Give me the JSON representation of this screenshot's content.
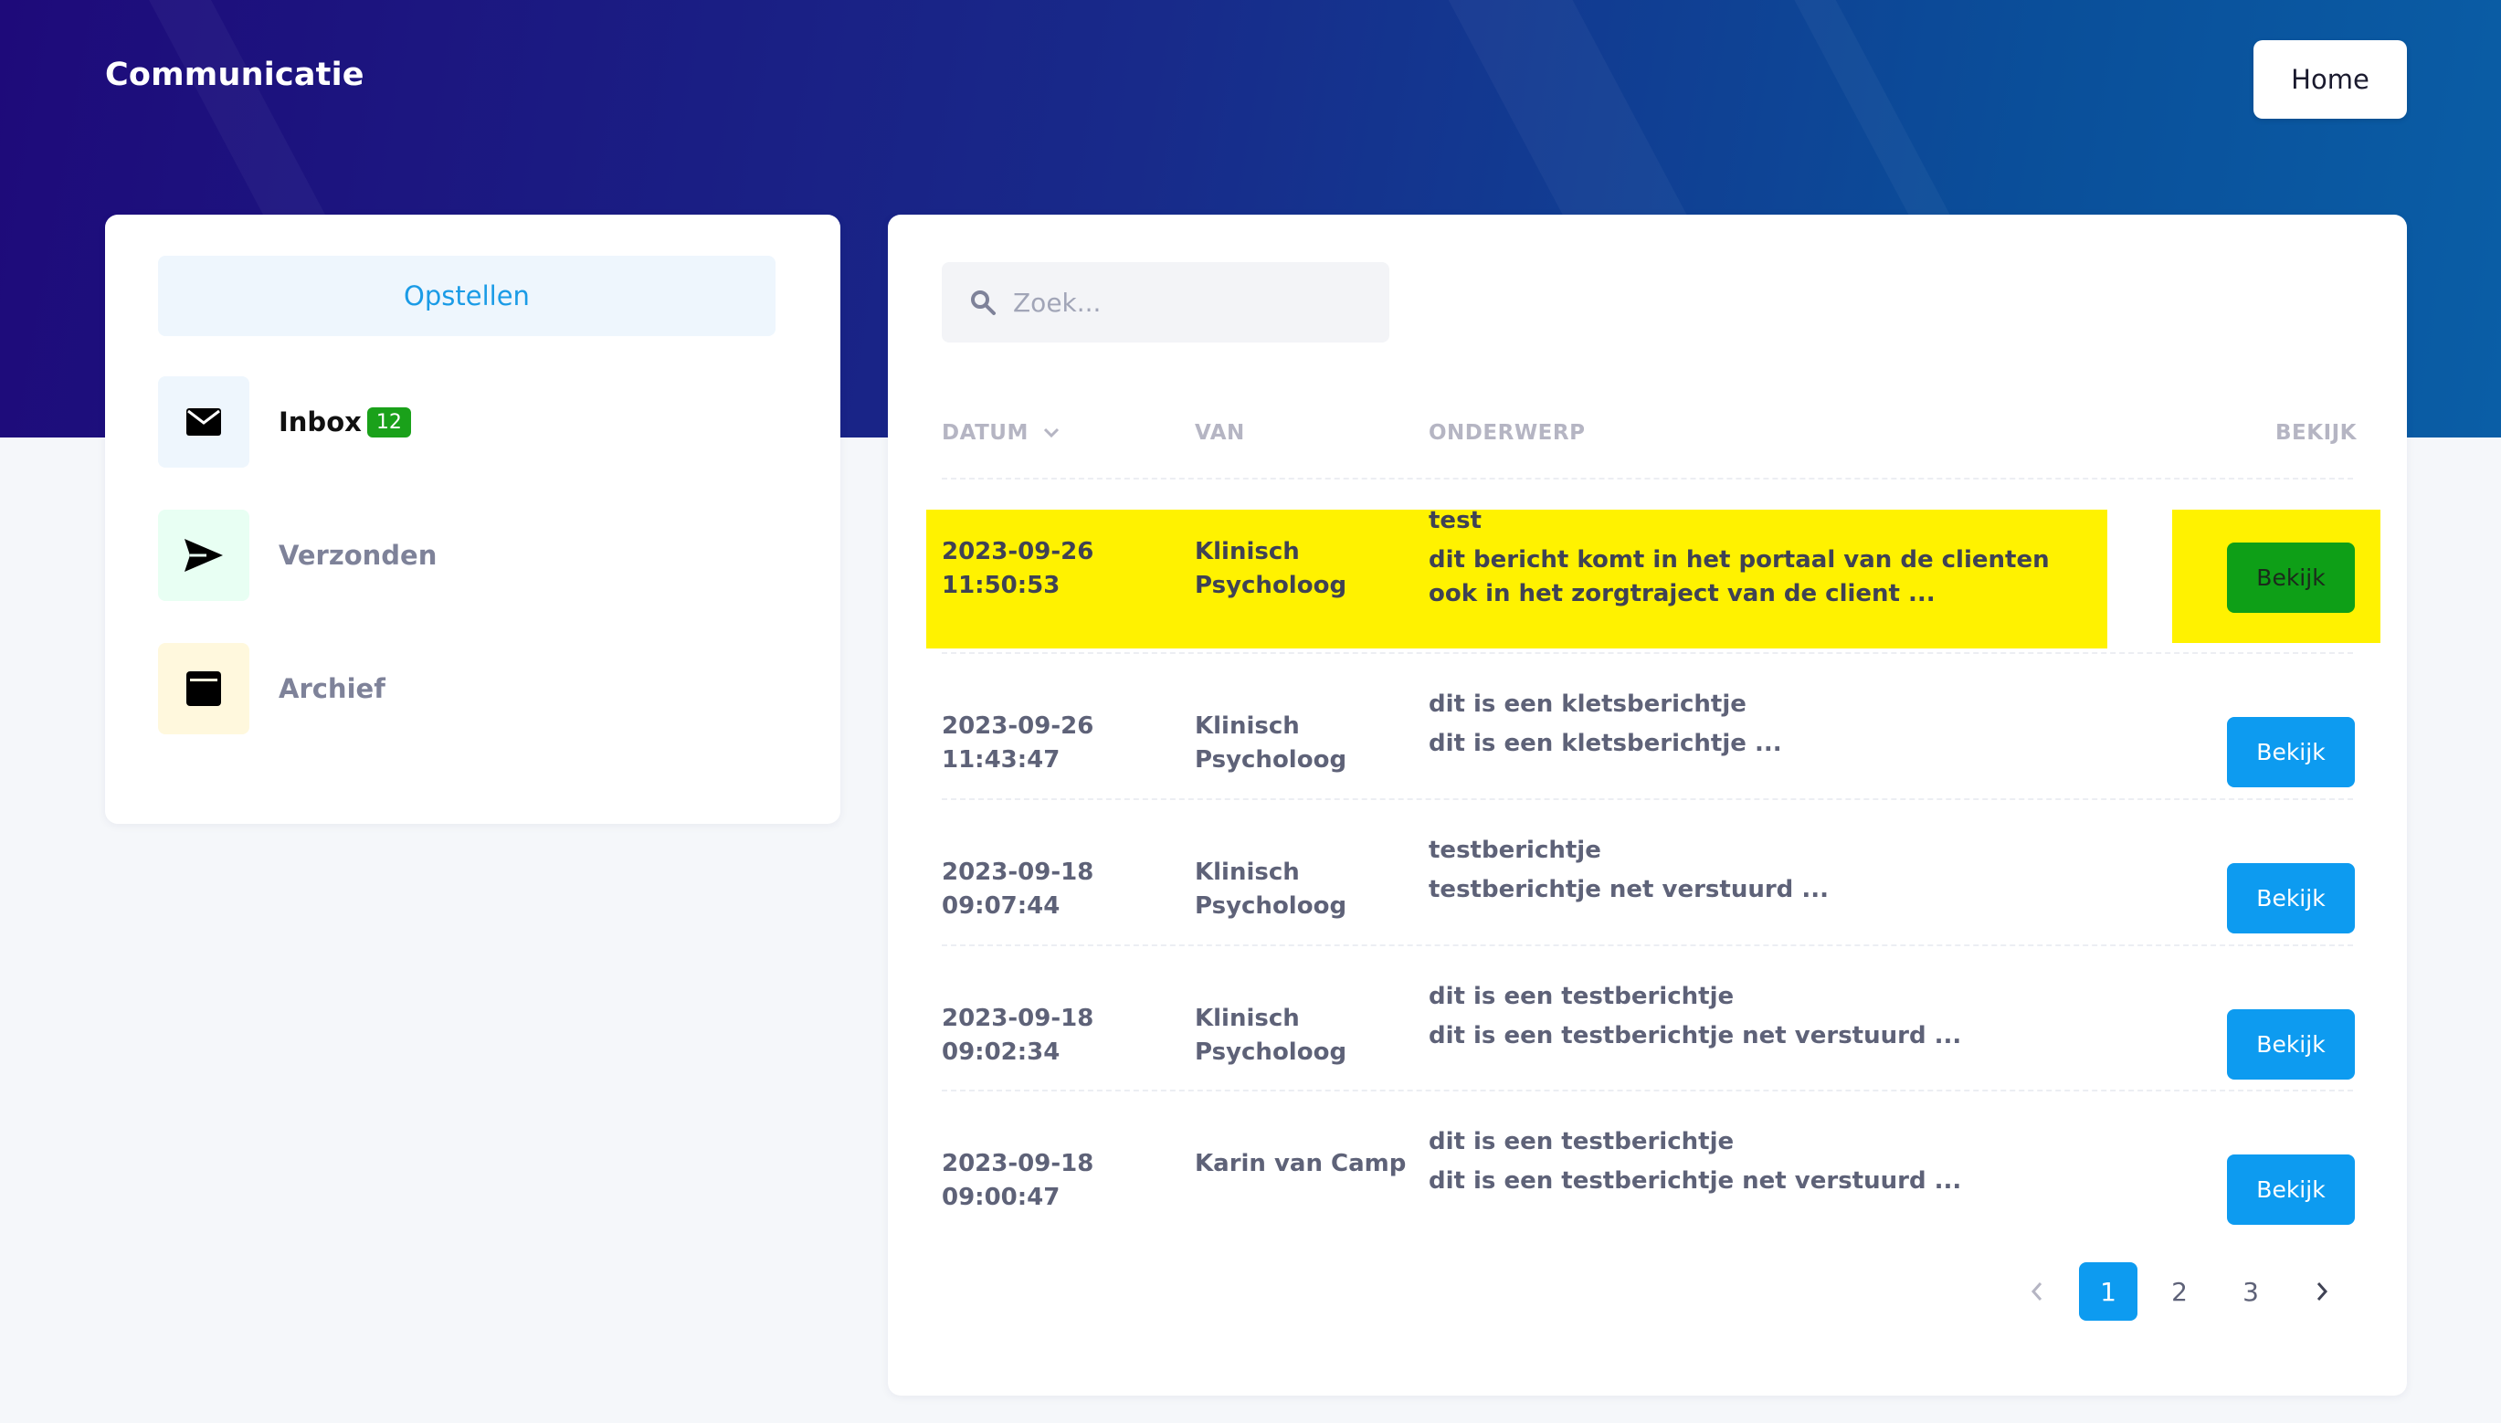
{
  "header": {
    "title": "Communicatie",
    "home_label": "Home"
  },
  "sidebar": {
    "compose_label": "Opstellen",
    "items": [
      {
        "label": "Inbox",
        "badge": "12",
        "icon": "envelope-icon"
      },
      {
        "label": "Verzonden",
        "icon": "send-icon"
      },
      {
        "label": "Archief",
        "icon": "archive-icon"
      }
    ]
  },
  "search": {
    "placeholder": "Zoek..."
  },
  "table": {
    "headers": {
      "date": "DATUM",
      "from": "VAN",
      "subject": "ONDERWERP",
      "view": "BEKIJK"
    },
    "rows": [
      {
        "date": "2023-09-26",
        "time": "11:50:53",
        "from_line1": "Klinisch",
        "from_line2": "Psycholoog",
        "subject": "test",
        "preview": "dit bericht komt in het portaal van de clienten ook in het zorgtraject van de client ...",
        "view_label": "Bekijk"
      },
      {
        "date": "2023-09-26",
        "time": "11:43:47",
        "from_line1": "Klinisch",
        "from_line2": "Psycholoog",
        "subject": "dit is een kletsberichtje",
        "preview": "dit is een kletsberichtje ...",
        "view_label": "Bekijk"
      },
      {
        "date": "2023-09-18",
        "time": "09:07:44",
        "from_line1": "Klinisch",
        "from_line2": "Psycholoog",
        "subject": "testberichtje",
        "preview": "testberichtje net verstuurd ...",
        "view_label": "Bekijk"
      },
      {
        "date": "2023-09-18",
        "time": "09:02:34",
        "from_line1": "Klinisch",
        "from_line2": "Psycholoog",
        "subject": "dit is een testberichtje",
        "preview": "dit is een testberichtje net verstuurd ...",
        "view_label": "Bekijk"
      },
      {
        "date": "2023-09-18",
        "time": "09:00:47",
        "from_line1": "Karin van Camp",
        "from_line2": "",
        "subject": "dit is een testberichtje",
        "preview": "dit is een testberichtje net verstuurd ...",
        "view_label": "Bekijk"
      }
    ]
  },
  "pagination": {
    "pages": [
      "1",
      "2",
      "3"
    ],
    "current": "1"
  },
  "colors": {
    "accent": "#0d9bf0",
    "highlight": "#fff200",
    "active_button": "#0e9f17",
    "badge": "#1aa11a"
  }
}
